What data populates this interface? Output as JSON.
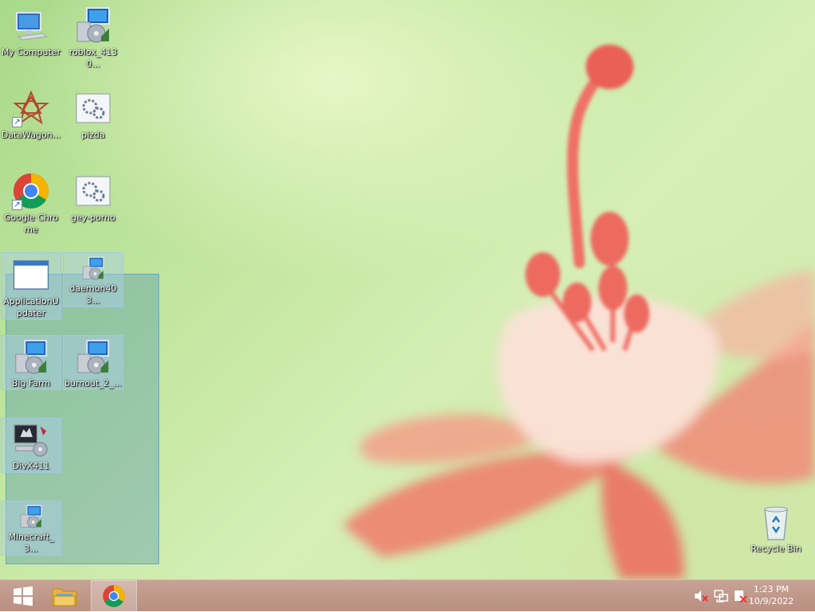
{
  "desktop": {
    "icons": [
      {
        "label": "My Computer",
        "icon": "computer-icon",
        "selected": false
      },
      {
        "label": "roblox_4130...",
        "icon": "installer-icon",
        "selected": false
      },
      {
        "label": "DataWagon...",
        "icon": "datawagon-icon",
        "selected": false,
        "shortcut": true
      },
      {
        "label": "pizda",
        "icon": "script-file-icon",
        "selected": false
      },
      {
        "label": "Google Chrome",
        "icon": "chrome-icon",
        "selected": false,
        "shortcut": true
      },
      {
        "label": "gey-porno",
        "icon": "script-file-icon",
        "selected": false
      },
      {
        "label": "ApplicationUpdater",
        "icon": "app-window-icon",
        "selected": true
      },
      {
        "label": "daemon403...",
        "icon": "installer-icon",
        "selected": true
      },
      {
        "label": "Big Farm",
        "icon": "installer-icon",
        "selected": true
      },
      {
        "label": "burnout_2_...",
        "icon": "installer-icon",
        "selected": true
      },
      {
        "label": "DivX411",
        "icon": "divx-installer-icon",
        "selected": true
      },
      {
        "label": "Minecraft_3...",
        "icon": "installer-icon",
        "selected": true
      },
      {
        "label": "Recycle Bin",
        "icon": "recycle-bin-icon",
        "selected": false
      }
    ]
  },
  "taskbar": {
    "buttons": [
      {
        "name": "start",
        "icon": "windows-logo-icon"
      },
      {
        "name": "file-explorer",
        "icon": "folder-icon"
      },
      {
        "name": "google-chrome",
        "icon": "chrome-icon",
        "active": true
      }
    ],
    "tray": [
      "speaker-muted-icon",
      "network-icon",
      "action-center-icon"
    ],
    "clock": {
      "time": "1:23 PM",
      "date": "10/9/2022"
    }
  },
  "colors": {
    "taskbar": "#b98f80",
    "selection": "#468caf",
    "wallpaper": "#c2e6a0"
  }
}
